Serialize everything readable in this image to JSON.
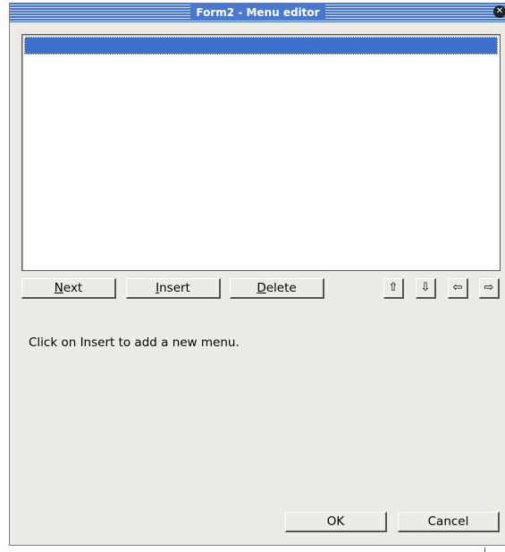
{
  "window": {
    "title": "Form2 - Menu editor",
    "close_icon": "close-icon"
  },
  "toolbar": {
    "next_mnemonic": "N",
    "next_rest": "ext",
    "insert_mnemonic": "I",
    "insert_rest": "nsert",
    "delete_mnemonic": "D",
    "delete_rest": "elete",
    "arrow_up": "⇧",
    "arrow_down": "⇩",
    "arrow_left": "⇦",
    "arrow_right": "⇨"
  },
  "hint": "Click on Insert to add a new menu.",
  "footer": {
    "ok_label": "OK",
    "cancel_label": "Cancel"
  }
}
